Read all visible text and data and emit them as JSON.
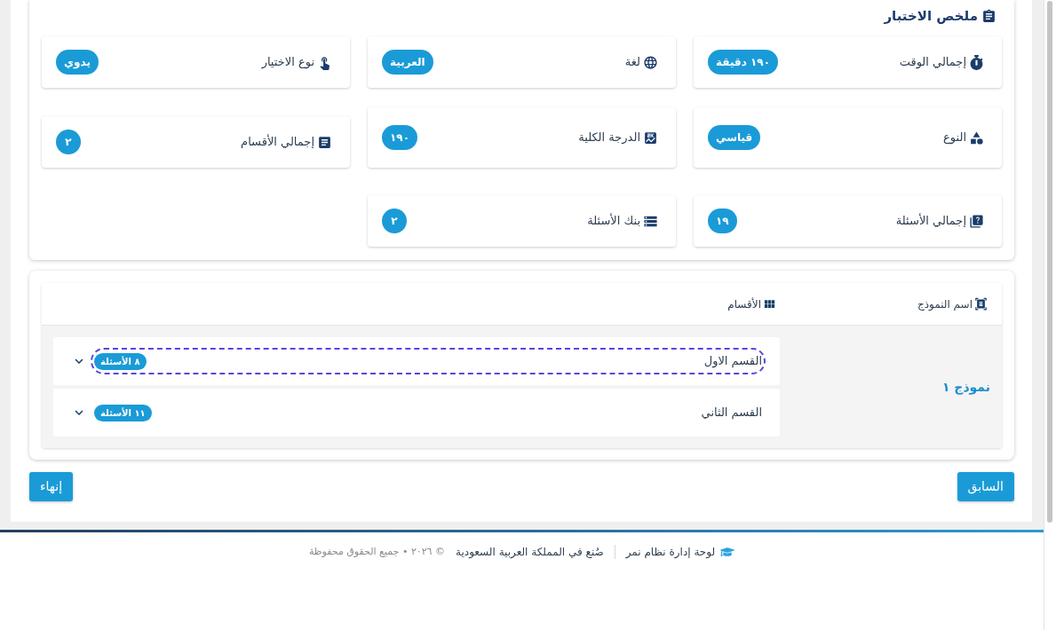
{
  "summary": {
    "title": "ملخص الاختبار",
    "items": [
      {
        "label": "إجمالي الوقت",
        "value": "١٩٠ دقيقة"
      },
      {
        "label": "لغة",
        "value": "العربية"
      },
      {
        "label": "نوع الاختيار",
        "value": "يدوي"
      },
      {
        "label": "النوع",
        "value": "قياسي"
      },
      {
        "label": "الدرجة الكلية",
        "value": "١٩٠"
      },
      {
        "label": "إجمالي الأقسام",
        "value": "٢"
      },
      {
        "label": "إجمالي الأسئلة",
        "value": "١٩"
      },
      {
        "label": "بنك الأسئلة",
        "value": "٢"
      }
    ]
  },
  "models_table": {
    "columns": [
      "اسم النموذج",
      "الأقسام"
    ],
    "rows": [
      {
        "model": "نموذج ١",
        "sections": [
          {
            "name": "القسم الاول",
            "count": "٨ الأسئلة",
            "expanded": false,
            "focused": true
          },
          {
            "name": "القسم الثاني",
            "count": "١١ الأسئلة",
            "expanded": false,
            "focused": false
          }
        ]
      }
    ]
  },
  "buttons": [
    "السابق",
    "إنهاء"
  ],
  "footer": {
    "brand": "لوحة إدارة نظام نمر",
    "made_in": "صُنع في المملكة العربية السعودية",
    "copyright": "© ٢٠٢٦ • جميع الحقوق محفوظة"
  }
}
